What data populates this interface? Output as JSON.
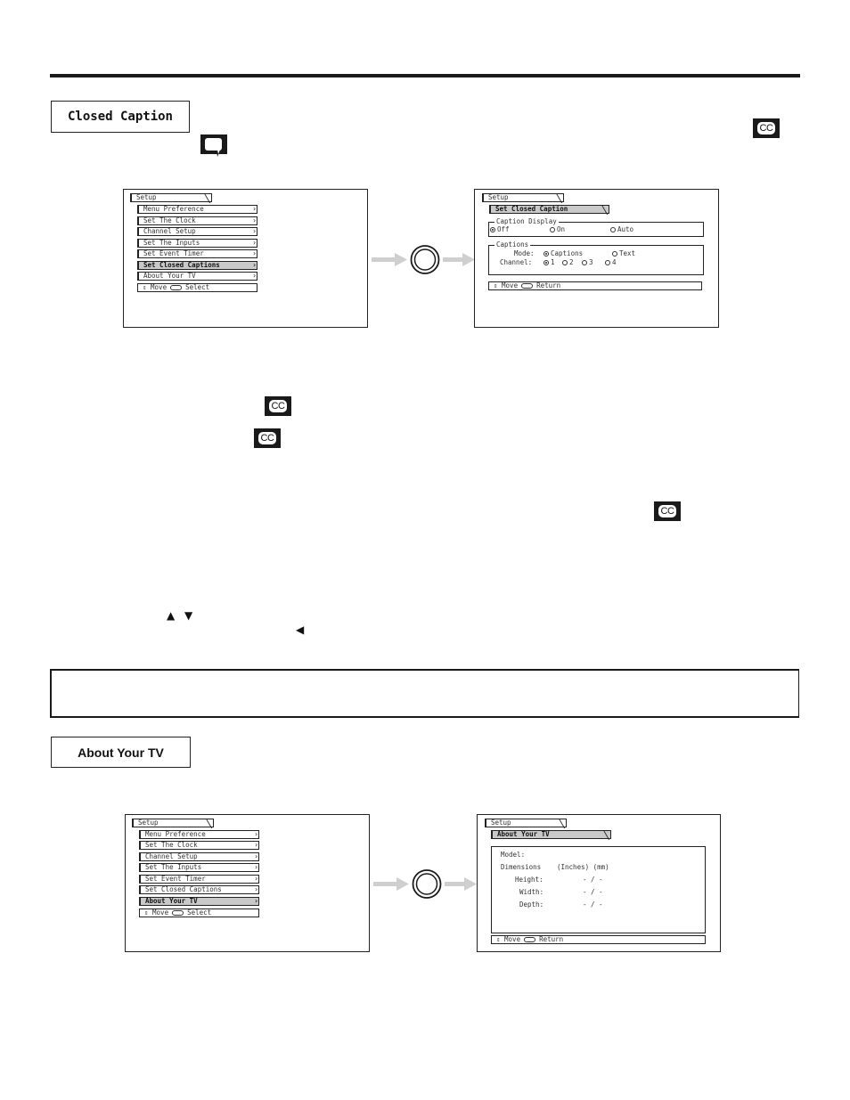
{
  "page": {
    "sections": [
      {
        "title": "Closed Caption",
        "menu_screen": {
          "tab": "Setup",
          "items": [
            {
              "label": "Menu Preference",
              "selected": false
            },
            {
              "label": "Set The Clock",
              "selected": false
            },
            {
              "label": "Channel Setup",
              "selected": false
            },
            {
              "label": "Set The Inputs",
              "selected": false
            },
            {
              "label": "Set Event Timer",
              "selected": false
            },
            {
              "label": "Set Closed Captions",
              "selected": true
            },
            {
              "label": "About Your TV",
              "selected": false
            }
          ],
          "hint": {
            "move": "Move",
            "action": "Select"
          }
        },
        "detail_screen": {
          "tab": "Setup",
          "subtab": "Set Closed Caption",
          "caption_display": {
            "legend": "Caption Display",
            "options": [
              "Off",
              "On",
              "Auto"
            ],
            "selected": "Off"
          },
          "captions": {
            "legend": "Captions",
            "mode_label": "Mode:",
            "mode_options": [
              "Captions",
              "Text"
            ],
            "mode_selected": "Captions",
            "channel_label": "Channel:",
            "channel_options": [
              "1",
              "2",
              "3",
              "4"
            ],
            "channel_selected": "1"
          },
          "hint": {
            "move": "Move",
            "action": "Return"
          }
        }
      },
      {
        "title": "About Your TV",
        "menu_screen": {
          "tab": "Setup",
          "items": [
            {
              "label": "Menu Preference",
              "selected": false
            },
            {
              "label": "Set The Clock",
              "selected": false
            },
            {
              "label": "Channel Setup",
              "selected": false
            },
            {
              "label": "Set The Inputs",
              "selected": false
            },
            {
              "label": "Set Event Timer",
              "selected": false
            },
            {
              "label": "Set Closed Captions",
              "selected": false
            },
            {
              "label": "About Your TV",
              "selected": true
            }
          ],
          "hint": {
            "move": "Move",
            "action": "Select"
          }
        },
        "detail_screen": {
          "tab": "Setup",
          "subtab": "About Your TV",
          "model_label": "Model:",
          "dimensions_label": "Dimensions",
          "units": "(Inches) (mm)",
          "rows": [
            {
              "label": "Height:",
              "value": "- / -"
            },
            {
              "label": "Width:",
              "value": "- / -"
            },
            {
              "label": "Depth:",
              "value": "- / -"
            }
          ],
          "hint": {
            "move": "Move",
            "action": "Return"
          }
        }
      }
    ],
    "icons": {
      "cc_label": "CC",
      "up_arrow": "▲",
      "down_arrow": "▼",
      "left_arrow": "◀",
      "move_glyph": "⇕"
    },
    "colors": {
      "highlight": "#c9c9c9",
      "flow_arrow": "#cfcfcf",
      "ink": "#1a1a1a"
    }
  }
}
